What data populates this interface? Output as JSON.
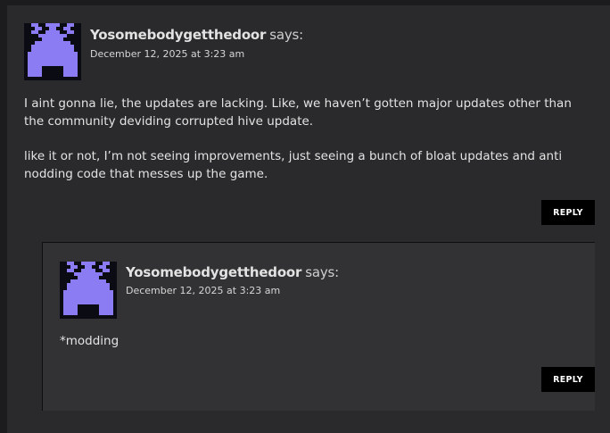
{
  "comment": {
    "author": "Yosomebodygetthedoor",
    "says": "says:",
    "date": "December 12, 2025 at 3:23 am",
    "paragraphs": [
      "I aint gonna lie, the updates are lacking. Like, we haven’t gotten major updates other than the community deviding corrupted hive update.",
      "like it or not, I’m not seeing improvements, just seeing a bunch of bloat updates and anti nodding code that messes up the game."
    ],
    "reply_label": "REPLY",
    "avatar_icon": "pixel-invader-avatar-icon"
  },
  "reply_comment": {
    "author": "Yosomebodygetthedoor",
    "says": "says:",
    "date": "December 12, 2025 at 3:23 am",
    "paragraphs": [
      "*modding"
    ],
    "reply_label": "REPLY",
    "avatar_icon": "pixel-invader-avatar-icon"
  },
  "colors": {
    "avatar_purple": "#8c7cf4",
    "avatar_bg": "#0b0b14",
    "button_bg": "#000000"
  }
}
